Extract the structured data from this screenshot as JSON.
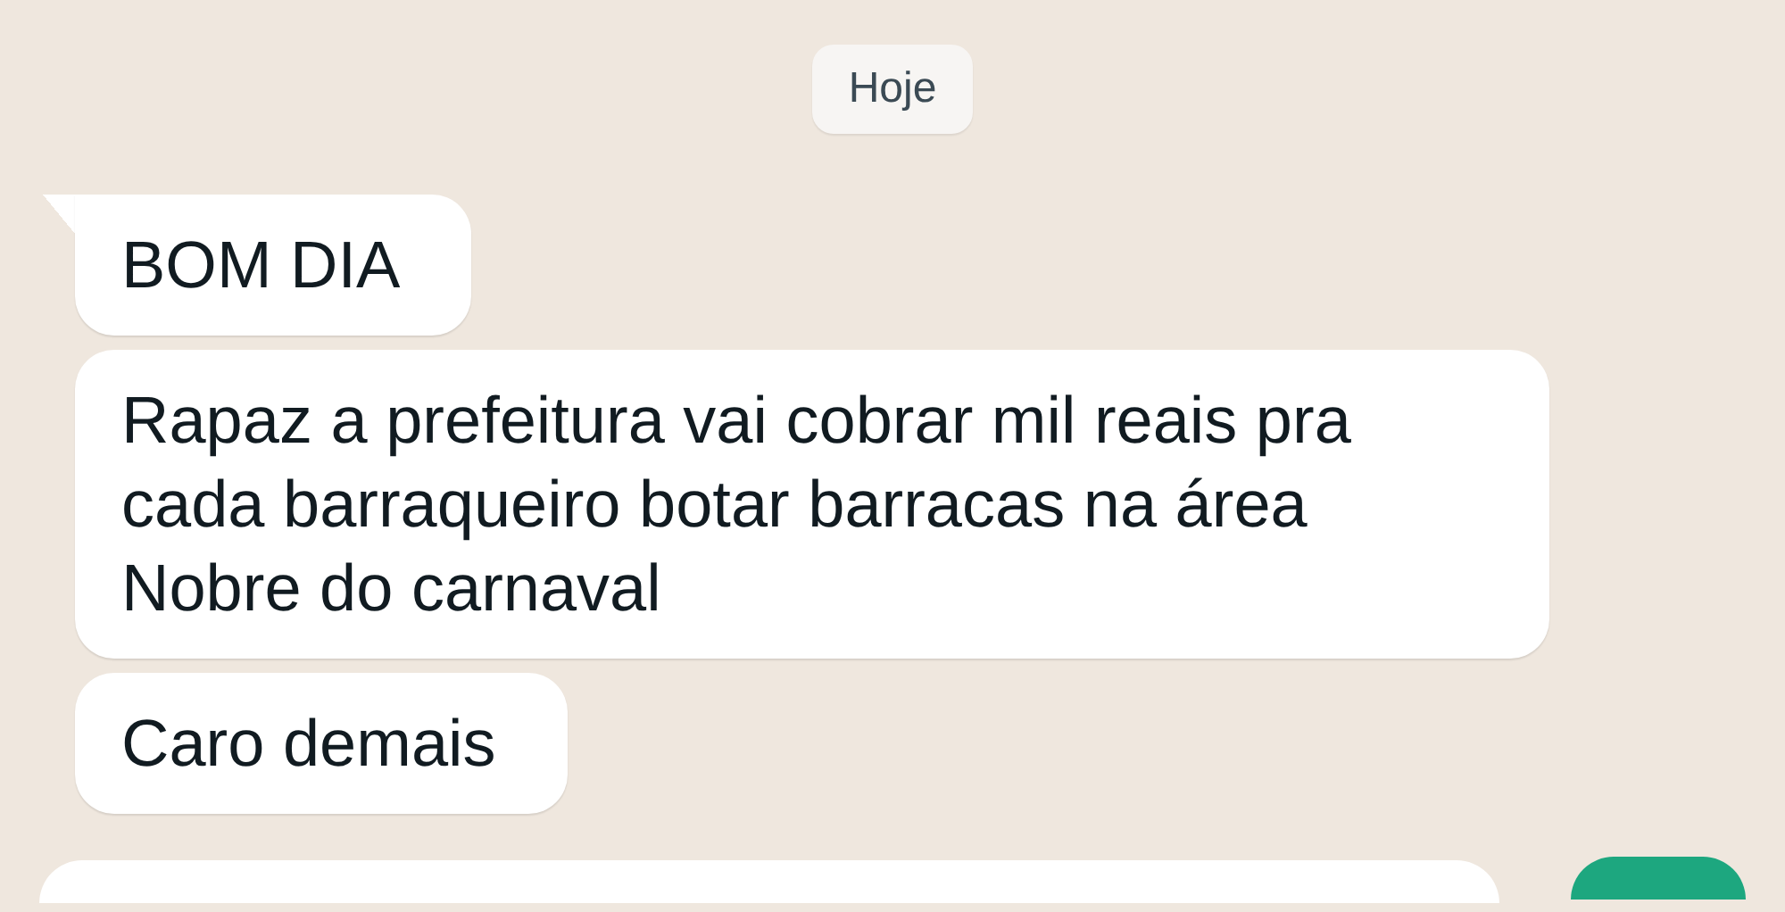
{
  "date_chip": "Hoje",
  "messages": [
    {
      "text": "BOM DIA",
      "tail": true
    },
    {
      "text": "Rapaz a prefeitura vai cobrar mil reais pra cada barraqueiro botar barracas na área Nobre do carnaval",
      "tail": false
    },
    {
      "text": "Caro demais",
      "tail": false
    }
  ]
}
